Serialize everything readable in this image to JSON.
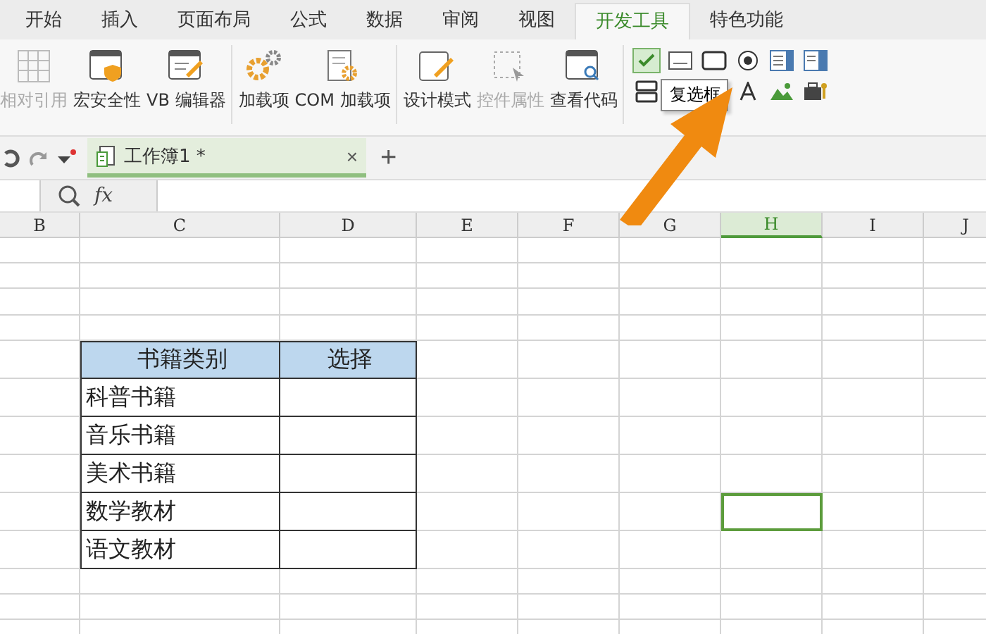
{
  "menu_tabs": [
    {
      "label": "开始",
      "selected": false
    },
    {
      "label": "插入",
      "selected": false
    },
    {
      "label": "页面布局",
      "selected": false
    },
    {
      "label": "公式",
      "selected": false
    },
    {
      "label": "数据",
      "selected": false
    },
    {
      "label": "审阅",
      "selected": false
    },
    {
      "label": "视图",
      "selected": false
    },
    {
      "label": "开发工具",
      "selected": true
    },
    {
      "label": "特色功能",
      "selected": false
    }
  ],
  "ribbon": {
    "groups": [
      [
        {
          "label": "相对引用",
          "disabled": true
        },
        {
          "label": "宏安全性",
          "disabled": false
        },
        {
          "label": "VB 编辑器",
          "disabled": false
        }
      ],
      [
        {
          "label": "加载项",
          "disabled": false
        },
        {
          "label": "COM 加载项",
          "disabled": false
        }
      ],
      [
        {
          "label": "设计模式",
          "disabled": false
        },
        {
          "label": "控件属性",
          "disabled": true
        },
        {
          "label": "查看代码",
          "disabled": false
        }
      ]
    ],
    "tooltip": "复选框"
  },
  "doc_tab": {
    "title": "工作簿1 *",
    "close": "×",
    "add": "+"
  },
  "formula_bar": {
    "fx": "fx"
  },
  "columns": [
    {
      "label": "B",
      "selected": false
    },
    {
      "label": "C",
      "selected": false
    },
    {
      "label": "D",
      "selected": false
    },
    {
      "label": "E",
      "selected": false
    },
    {
      "label": "F",
      "selected": false
    },
    {
      "label": "G",
      "selected": false
    },
    {
      "label": "H",
      "selected": true
    },
    {
      "label": "I",
      "selected": false
    },
    {
      "label": "J",
      "selected": false
    }
  ],
  "table": {
    "header": [
      "书籍类别",
      "选择"
    ],
    "rows": [
      "科普书籍",
      "音乐书籍",
      "美术书籍",
      "数学教材",
      "语文教材"
    ]
  }
}
